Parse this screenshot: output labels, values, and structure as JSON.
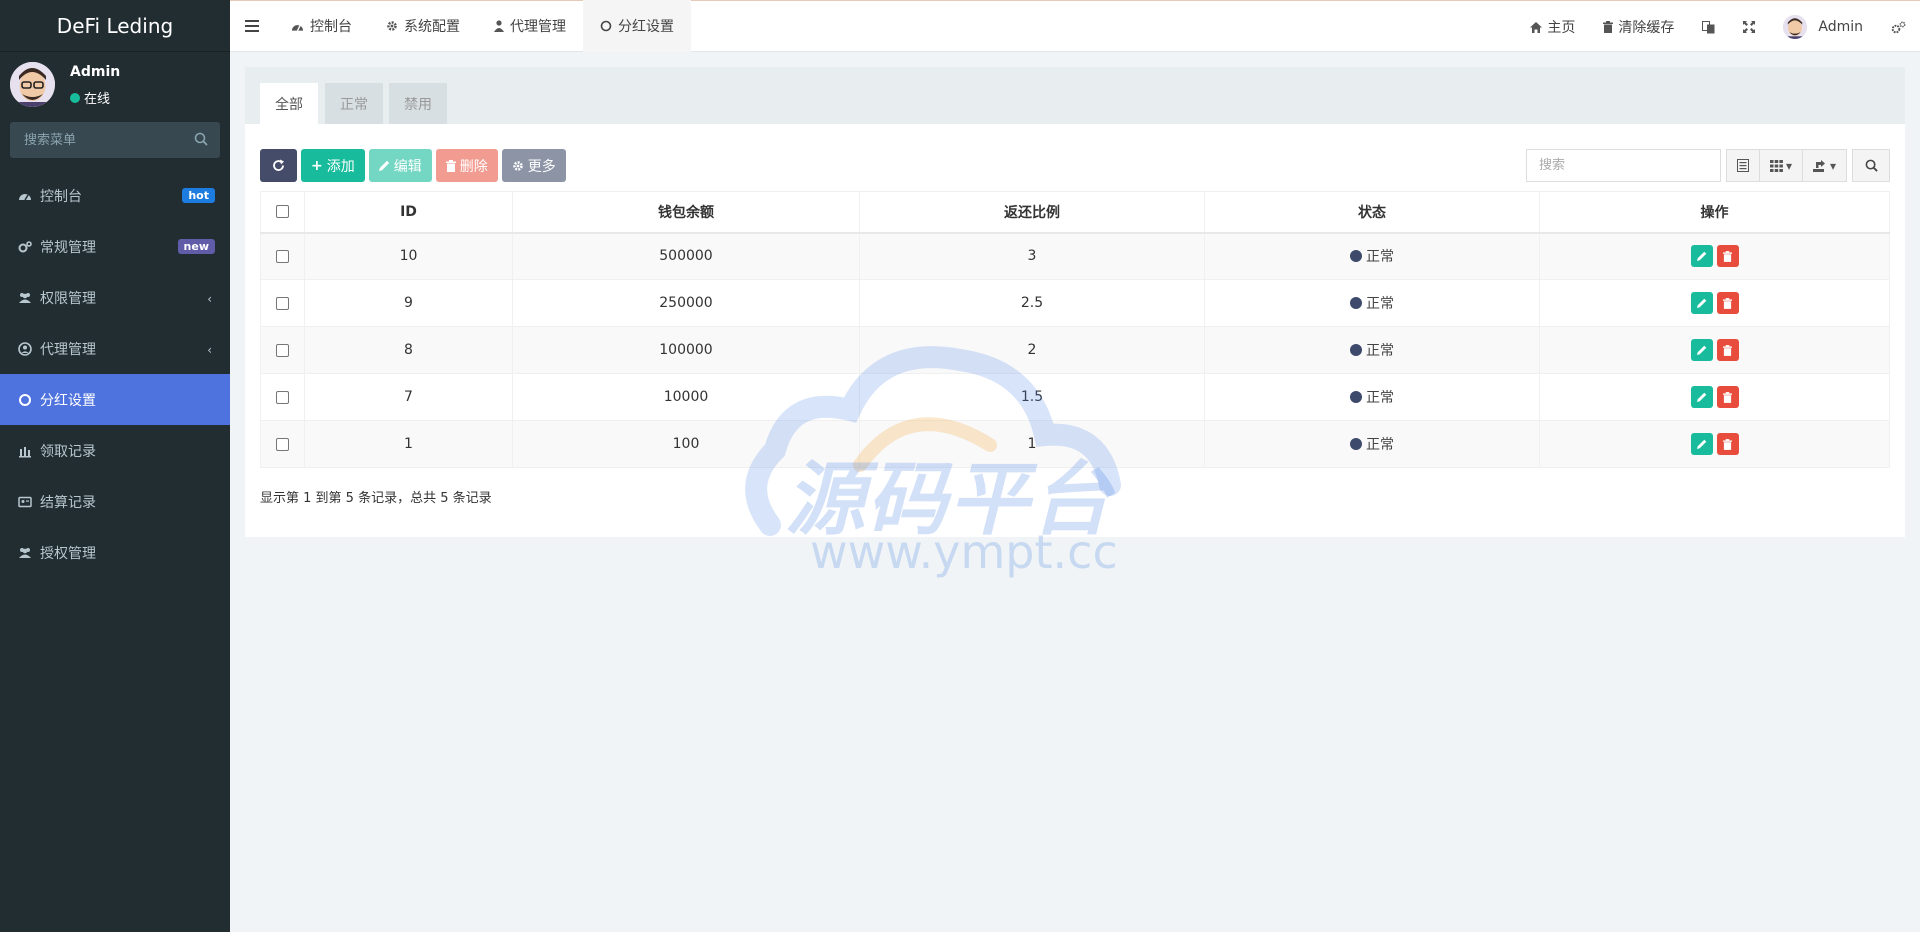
{
  "sidebar": {
    "brand": "DeFi Leding",
    "user": {
      "name": "Admin",
      "status": "在线"
    },
    "search_placeholder": "搜索菜单",
    "items": [
      {
        "label": "控制台",
        "icon": "dashboard-icon",
        "badge": "hot"
      },
      {
        "label": "常规管理",
        "icon": "cogs-icon",
        "badge": "new"
      },
      {
        "label": "权限管理",
        "icon": "group-icon",
        "has_children": true
      },
      {
        "label": "代理管理",
        "icon": "user-circle-icon",
        "has_children": true
      },
      {
        "label": "分红设置",
        "icon": "circle-icon",
        "active": true
      },
      {
        "label": "领取记录",
        "icon": "bar-chart-icon"
      },
      {
        "label": "结算记录",
        "icon": "id-card-icon"
      },
      {
        "label": "授权管理",
        "icon": "group-icon"
      }
    ]
  },
  "navbar": {
    "tabs": [
      {
        "label": "控制台",
        "icon": "dashboard-icon"
      },
      {
        "label": "系统配置",
        "icon": "gear-icon"
      },
      {
        "label": "代理管理",
        "icon": "user-icon"
      },
      {
        "label": "分红设置",
        "icon": "circle-icon",
        "active": true
      }
    ],
    "right": {
      "home": "主页",
      "clear_cache": "清除缓存",
      "user": "Admin"
    }
  },
  "content": {
    "subtabs": [
      "全部",
      "正常",
      "禁用"
    ],
    "toolbar": {
      "add": "添加",
      "edit": "编辑",
      "delete": "删除",
      "more": "更多"
    },
    "search_placeholder": "搜索",
    "table": {
      "headers": [
        "ID",
        "钱包余额",
        "返还比例",
        "状态",
        "操作"
      ],
      "rows": [
        {
          "id": "10",
          "balance": "500000",
          "ratio": "3",
          "status": "正常"
        },
        {
          "id": "9",
          "balance": "250000",
          "ratio": "2.5",
          "status": "正常"
        },
        {
          "id": "8",
          "balance": "100000",
          "ratio": "2",
          "status": "正常"
        },
        {
          "id": "7",
          "balance": "10000",
          "ratio": "1.5",
          "status": "正常"
        },
        {
          "id": "1",
          "balance": "100",
          "ratio": "1",
          "status": "正常"
        }
      ]
    },
    "page_info": "显示第 1 到第 5 条记录，总共 5 条记录"
  },
  "watermark": {
    "title": "源码平台",
    "url": "www.ympt.cc"
  },
  "colors": {
    "sidebar_bg": "#222d32",
    "active": "#4e73df",
    "success": "#18bc9c",
    "danger": "#e74c3c"
  }
}
